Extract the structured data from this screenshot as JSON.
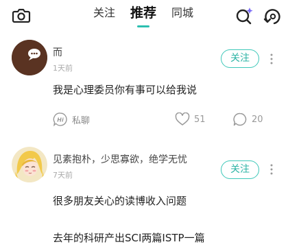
{
  "header": {
    "tabs": [
      {
        "label": "关注",
        "active": false
      },
      {
        "label": "推荐",
        "active": true
      },
      {
        "label": "同城",
        "active": false
      }
    ],
    "icons": [
      "camera-icon",
      "search-sparkle-icon",
      "refresh-icon"
    ],
    "accent_color": "#2bbfb0"
  },
  "posts": [
    {
      "username": "而",
      "time": "1天前",
      "follow_label": "关注",
      "content": [
        "我是心理委员你有事可以给我说"
      ],
      "dm_label": "私聊",
      "likes": "51",
      "comments": "20"
    },
    {
      "username": "见素抱朴，少思寡欲，绝学无忧",
      "time": "7天前",
      "follow_label": "关注",
      "content": [
        "很多朋友关心的读博收入问题",
        "去年的科研产出SCI两篇ISTP一篇"
      ]
    }
  ]
}
